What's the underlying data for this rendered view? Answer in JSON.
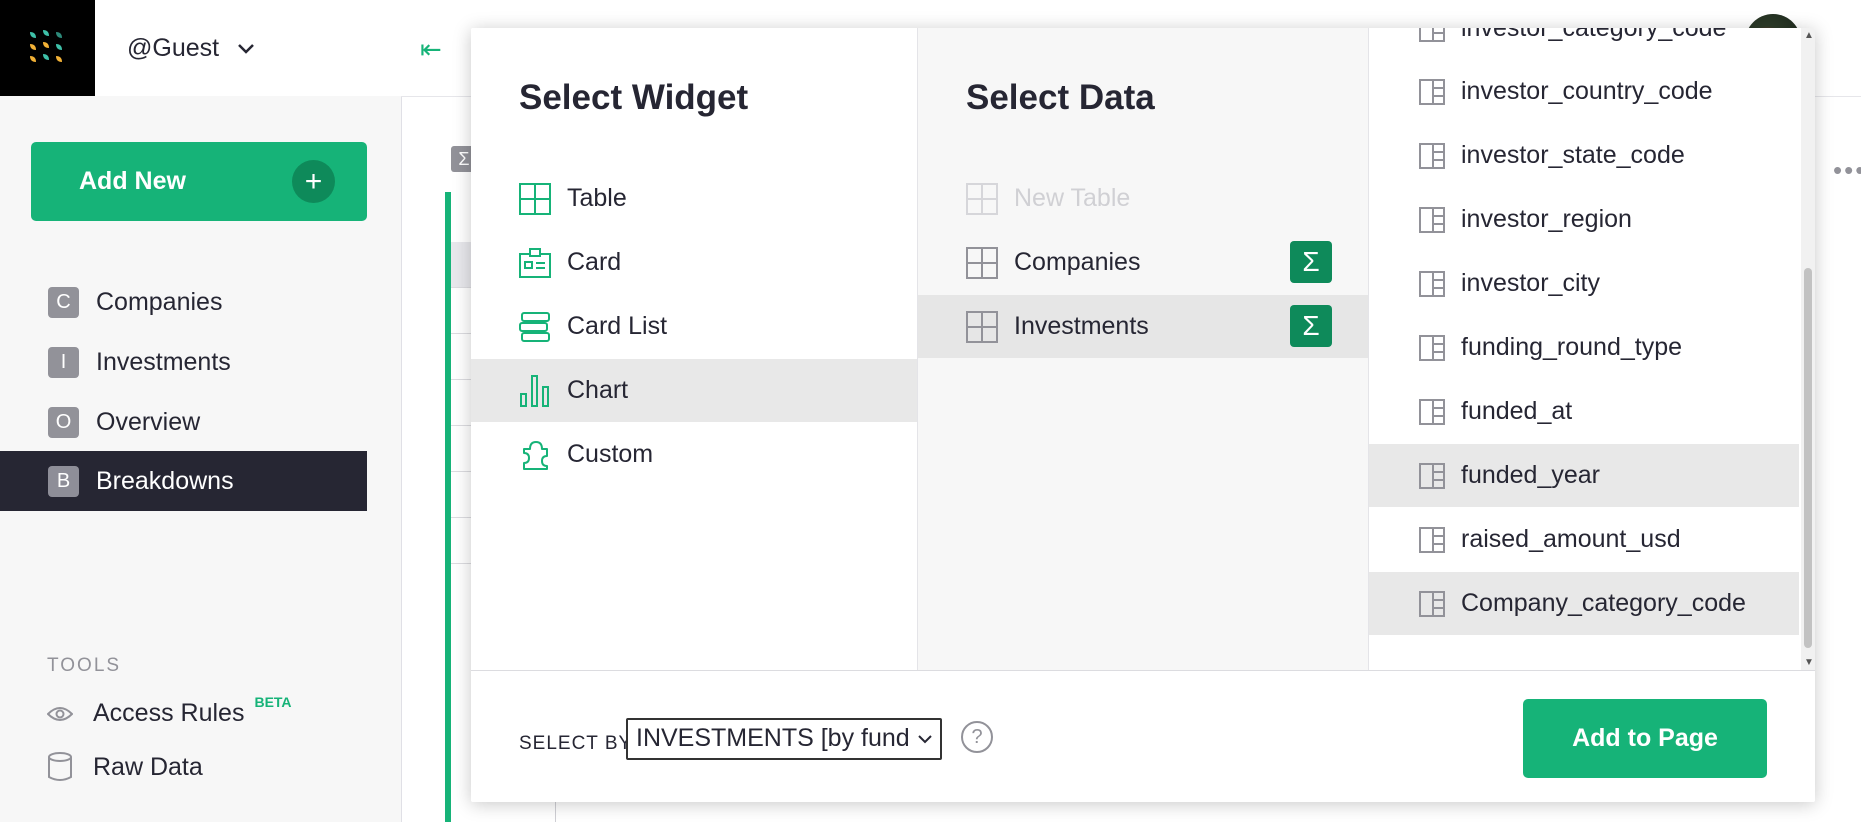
{
  "header": {
    "account": "@Guest"
  },
  "sidebar": {
    "add_new": "Add New",
    "pages": [
      {
        "initial": "C",
        "label": "Companies"
      },
      {
        "initial": "I",
        "label": "Investments"
      },
      {
        "initial": "O",
        "label": "Overview"
      },
      {
        "initial": "B",
        "label": "Breakdowns",
        "active": true
      }
    ],
    "tools_heading": "TOOLS",
    "tools": [
      {
        "label": "Access Rules",
        "badge": "BETA",
        "icon": "eye-icon"
      },
      {
        "label": "Raw Data",
        "icon": "database-icon"
      }
    ]
  },
  "background": {
    "summary_badge": "Σ",
    "more": "•••"
  },
  "modal": {
    "widget_title": "Select Widget",
    "widgets": [
      {
        "label": "Table",
        "icon": "table-icon"
      },
      {
        "label": "Card",
        "icon": "card-icon"
      },
      {
        "label": "Card List",
        "icon": "card-list-icon"
      },
      {
        "label": "Chart",
        "icon": "chart-icon",
        "selected": true
      },
      {
        "label": "Custom",
        "icon": "custom-widget-icon"
      }
    ],
    "data_title": "Select Data",
    "data": [
      {
        "label": "New Table",
        "disabled": true
      },
      {
        "label": "Companies",
        "sigma": "Σ"
      },
      {
        "label": "Investments",
        "sigma": "Σ",
        "selected": true
      }
    ],
    "fields": [
      {
        "label": "investor_category_code"
      },
      {
        "label": "investor_country_code"
      },
      {
        "label": "investor_state_code"
      },
      {
        "label": "investor_region"
      },
      {
        "label": "investor_city"
      },
      {
        "label": "funding_round_type"
      },
      {
        "label": "funded_at"
      },
      {
        "label": "funded_year",
        "selected": true
      },
      {
        "label": "raised_amount_usd"
      },
      {
        "label": "Company_category_code",
        "selected": true
      }
    ],
    "footer": {
      "select_by_label": "SELECT BY",
      "select_by_value": "INVESTMENTS [by funde",
      "help": "?",
      "add_button": "Add to Page"
    }
  },
  "colors": {
    "accent": "#16b378",
    "dark_accent": "#0e8a5a",
    "sidebar_active": "#262633"
  }
}
